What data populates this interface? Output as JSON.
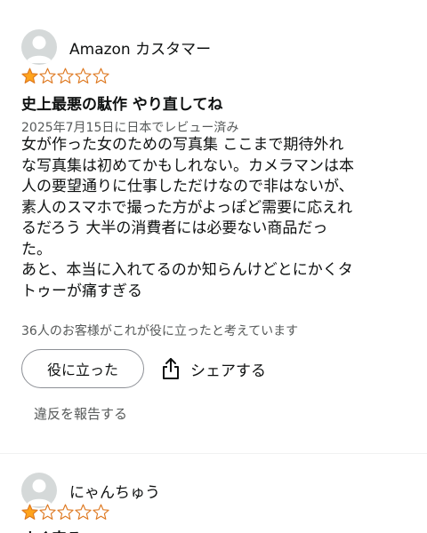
{
  "colors": {
    "star_filled": "#ffa41c",
    "star_empty": "#de7921",
    "text_primary": "#0f1111",
    "text_secondary": "#565959",
    "avatar_bg": "#d5d9d9"
  },
  "reviews": [
    {
      "author": "Amazon カスタマー",
      "avatar_icon": "default-user-icon",
      "rating": 1,
      "rating_max": 5,
      "title": "史上最悪の駄作 やり直してね",
      "date": "2025年7月15日に日本でレビュー済み",
      "body_lines": [
        "女が作った女のための写真集 ここまで期待外れ",
        "な写真集は初めてかもしれない。カメラマンは本",
        "人の要望通りに仕事しただけなので非はないが、",
        "素人のスマホで撮った方がよっぽど需要に応えれ",
        "るだろう 大半の消費者には必要ない商品だっ",
        "た。",
        "あと、本当に入れてるのか知らんけどとにかくタ",
        "トゥーが痛すぎる"
      ],
      "helpful_count_text": "36人のお客様がこれが役に立ったと考えています",
      "helpful_button_label": "役に立った",
      "share_label": "シェアする",
      "share_icon": "share-icon",
      "report_label": "違反を報告する"
    },
    {
      "author": "にゃんちゅう",
      "avatar_icon": "default-user-icon",
      "rating": 1,
      "rating_max": 5,
      "title": "すぐ来る"
    }
  ]
}
